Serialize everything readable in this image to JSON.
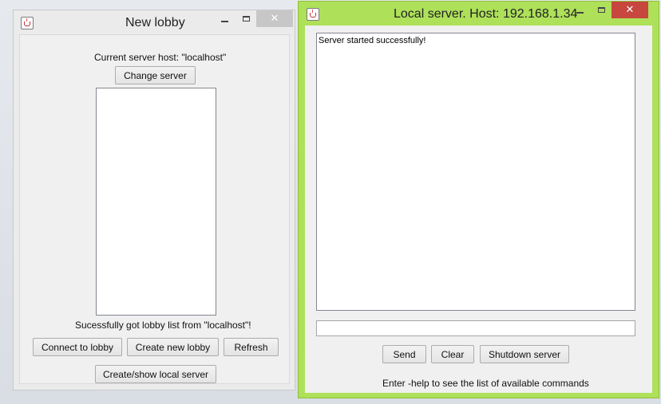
{
  "window_lobby": {
    "title": "New lobby",
    "icon": "java-cup-icon",
    "controls": {
      "minimize": "minimize-icon",
      "maximize": "maximize-icon",
      "close": "✕"
    },
    "server_host_text": "Current server host: \"localhost\"",
    "change_server_label": "Change server",
    "lobby_list_items": [],
    "status_text": "Sucessfully got lobby list from \"localhost\"!",
    "buttons": {
      "connect": "Connect to lobby",
      "create": "Create new lobby",
      "refresh": "Refresh",
      "local_server": "Create/show local server"
    }
  },
  "window_server": {
    "title": "Local server. Host: 192.168.1.34",
    "icon": "java-cup-icon",
    "controls": {
      "minimize": "minimize-icon",
      "maximize": "maximize-icon",
      "close": "✕"
    },
    "log_text": "Server started successfully!",
    "command_input_value": "",
    "buttons": {
      "send": "Send",
      "clear": "Clear",
      "shutdown": "Shutdown server"
    },
    "help_text": "Enter -help to see the list of available commands"
  },
  "colors": {
    "active_frame": "#aee05a",
    "close_active": "#c7463d",
    "close_inactive": "#c7c7c7",
    "client_bg": "#f0f0f0"
  }
}
